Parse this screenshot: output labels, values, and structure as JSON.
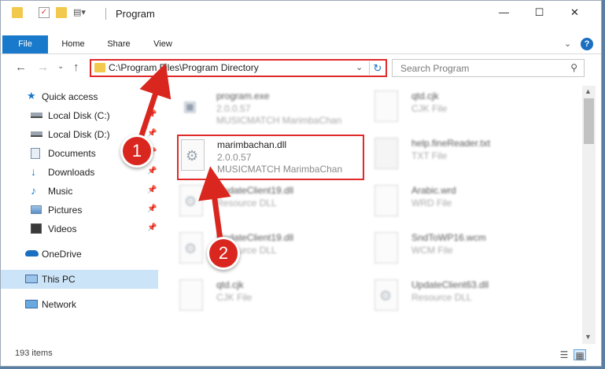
{
  "window": {
    "title": "Program",
    "minimize_glyph": "—",
    "maximize_glyph": "☐",
    "close_glyph": "✕"
  },
  "ribbon": {
    "tabs": [
      "File",
      "Home",
      "Share",
      "View"
    ],
    "help_glyph": "?"
  },
  "navigation": {
    "back_glyph": "←",
    "forward_glyph": "→",
    "recent_glyph": "⌄",
    "up_glyph": "↑",
    "address_path": "C:\\Program Files\\Program Directory",
    "search_placeholder": "Search Program"
  },
  "sidebar": {
    "items": [
      {
        "label": "Quick access",
        "icon": "star-icon",
        "pinned": false
      },
      {
        "label": "Local Disk (C:)",
        "icon": "drive-icon",
        "pinned": true
      },
      {
        "label": "Local Disk (D:)",
        "icon": "drive-icon",
        "pinned": true
      },
      {
        "label": "Documents",
        "icon": "documents-icon",
        "pinned": true
      },
      {
        "label": "Downloads",
        "icon": "download-icon",
        "pinned": true
      },
      {
        "label": "Music",
        "icon": "music-icon",
        "pinned": true
      },
      {
        "label": "Pictures",
        "icon": "pictures-icon",
        "pinned": true
      },
      {
        "label": "Videos",
        "icon": "videos-icon",
        "pinned": true
      },
      {
        "label": "OneDrive",
        "icon": "cloud-icon",
        "pinned": false
      },
      {
        "label": "This PC",
        "icon": "computer-icon",
        "pinned": false,
        "selected": true
      },
      {
        "label": "Network",
        "icon": "network-icon",
        "pinned": false
      }
    ]
  },
  "files": [
    {
      "name": "program.exe",
      "line1": "2.0.0.57",
      "line2": "MUSICMATCH MarimbaChan"
    },
    {
      "name": "qtd.cjk",
      "line1": "CJK File",
      "line2": ""
    },
    {
      "name": "marimbachan.dll",
      "line1": "2.0.0.57",
      "line2": "MUSICMATCH MarimbaChan",
      "highlighted": true
    },
    {
      "name": "help.fineReader.txt",
      "line1": "TXT File",
      "line2": ""
    },
    {
      "name": "UpdateClient19.dll",
      "line1": "Resource DLL",
      "line2": ""
    },
    {
      "name": "Arabic.wrd",
      "line1": "WRD File",
      "line2": ""
    },
    {
      "name": "UpdateClient19.dll",
      "line1": "Resource DLL",
      "line2": ""
    },
    {
      "name": "SndToWP16.wcm",
      "line1": "WCM File",
      "line2": ""
    },
    {
      "name": "qtd.cjk",
      "line1": "CJK File",
      "line2": ""
    },
    {
      "name": "UpdateClient63.dll",
      "line1": "Resource DLL",
      "line2": ""
    }
  ],
  "statusbar": {
    "item_count": "193 items"
  },
  "annotations": {
    "step1": "1",
    "step2": "2",
    "color": "#d9271f"
  },
  "colors": {
    "accent": "#1979ca",
    "selected_bg": "#cce4f7",
    "highlight": "#e02a2a"
  }
}
